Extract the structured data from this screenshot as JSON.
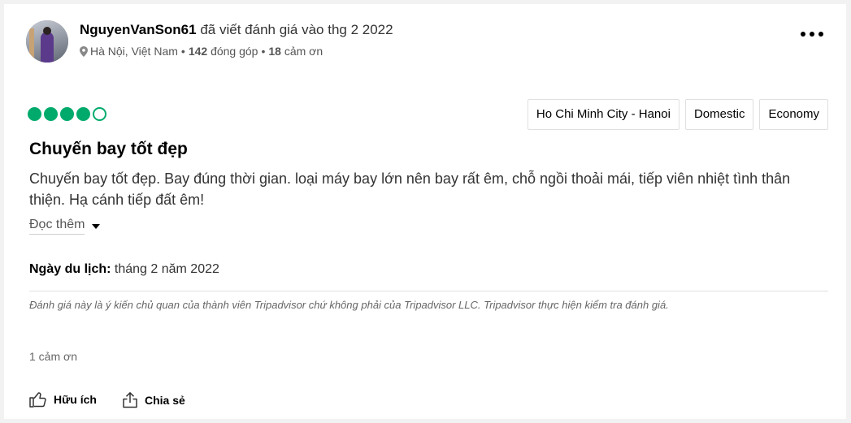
{
  "review": {
    "username": "NguyenVanSon61",
    "wrote_text": "đã viết đánh giá vào thg 2 2022",
    "location": "Hà Nội, Việt Nam",
    "contributions_count": "142",
    "contributions_label": "đóng góp",
    "thanks_count": "18",
    "thanks_label": "cảm ơn",
    "separator": "•",
    "rating": 4,
    "rating_max": 5,
    "tags": [
      "Ho Chi Minh City - Hanoi",
      "Domestic",
      "Economy"
    ],
    "title": "Chuyến bay tốt đẹp",
    "body": "Chuyến bay tốt đẹp. Bay đúng thời gian. loại máy bay lớn nên bay rất êm, chỗ ngồi thoải mái, tiếp viên nhiệt tình thân thiện. Hạ cánh tiếp đất êm!",
    "read_more": "Đọc thêm",
    "travel_date_label": "Ngày du lịch:",
    "travel_date_value": "tháng 2 năm 2022",
    "disclaimer": "Đánh giá này là ý kiến chủ quan của thành viên Tripadvisor chứ không phải của Tripadvisor LLC. Tripadvisor thực hiện kiểm tra đánh giá.",
    "thanks_received": "1 cảm ơn",
    "helpful_label": "Hữu ích",
    "share_label": "Chia sẻ"
  },
  "colors": {
    "rating_green": "#00aa6c",
    "background": "#f2f2f2",
    "card": "#ffffff"
  },
  "icons": [
    "map-pin-icon",
    "more-options-icon",
    "thumbs-up-icon",
    "share-icon"
  ]
}
